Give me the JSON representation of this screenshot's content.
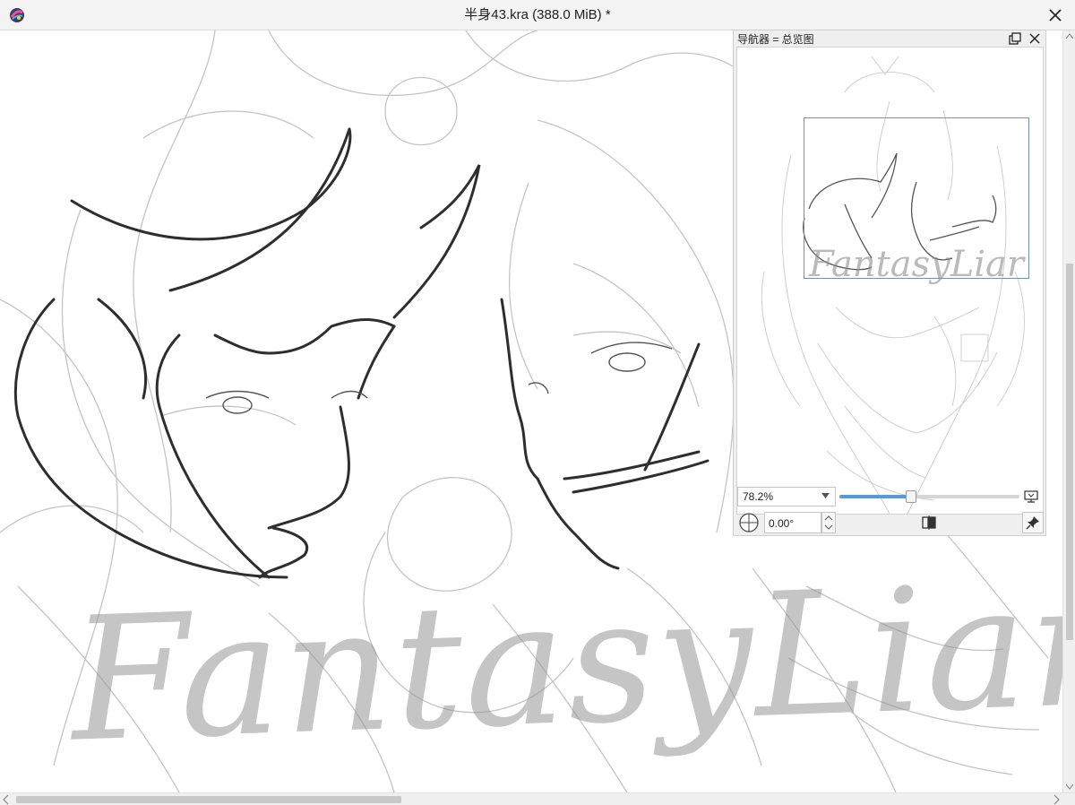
{
  "window": {
    "title": "半身43.kra (388.0 MiB) *",
    "app_icon": "krita-logo-icon",
    "close_icon": "close-icon"
  },
  "canvas": {
    "watermark_text": "FantasyLiar"
  },
  "navigator": {
    "title": "导航器 = 总览图",
    "float_icon": "float-docker-icon",
    "close_icon": "close-icon",
    "zoom_value": "78.2%",
    "zoom_slider_fraction": 0.39,
    "rotation_value": "0.00°",
    "icons": {
      "rotate": "rotation-dial-icon",
      "fit": "fit-to-view-icon",
      "mirror": "mirror-canvas-icon",
      "pin": "pin-icon"
    }
  },
  "colors": {
    "viewport_rect": "#6e93b6",
    "slider_fill": "#5b9bd5"
  }
}
